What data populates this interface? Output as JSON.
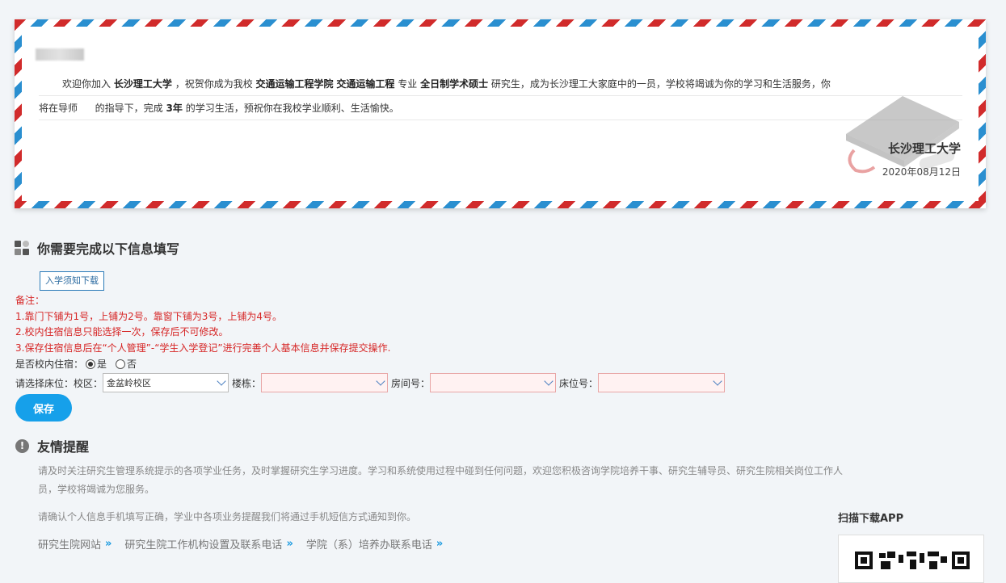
{
  "letter": {
    "intro": "欢迎你加入",
    "university": "长沙理工大学",
    "congrats": "，祝贺你成为我校",
    "college": "交通运输工程学院",
    "major": "交通运输工程",
    "major_suffix": "专业",
    "degree": "全日制学术硕士",
    "line1_tail": "研究生，成为长沙理工大家庭中的一员，学校将竭诚为你的学习和生活服务，你",
    "line2_a": "将在导师",
    "line2_b": "的指导下，完成",
    "years": "3年",
    "line2_c": "的学习生活，预祝你在我校学业顺利、生活愉快。",
    "signature": "长沙理工大学",
    "date": "2020年08月12日"
  },
  "section": {
    "title": "你需要完成以下信息填写",
    "notice_button": "入学须知下载",
    "remarks": [
      "备注：",
      "1.靠门下铺为1号，上铺为2号。靠窗下铺为3号，上铺为4号。",
      "2.校内住宿信息只能选择一次，保存后不可修改。",
      "3.保存住宿信息后在“个人管理”-“学生入学登记”进行完善个人基本信息并保存提交操作."
    ],
    "live_on_campus_label": "是否校内住宿：",
    "option_yes": "是",
    "option_no": "否",
    "bed_label": "请选择床位：校区：",
    "campus_value": "金盆岭校区",
    "building_label": "楼栋：",
    "building_value": "",
    "room_label": "房间号：",
    "room_value": "",
    "bed_no_label": "床位号：",
    "bed_no_value": "",
    "save_button": "保存"
  },
  "reminder": {
    "title": "友情提醒",
    "tip1_a": "请及时关注研究生管理系统提示的各项学业任务，及时掌握研究生学习进度。学习和系统使用过程中碰到任何问题，欢迎您积极咨询学院培养干事、研究生辅导员、研究生院相关岗位工作人",
    "tip1_b": "员，学校将竭诚为您服务。",
    "tip2": "请确认个人信息手机填写正确，学业中各项业务提醒我们将通过手机短信方式通知到你。",
    "links": [
      "研究生院网站",
      "研究生院工作机构设置及联系电话",
      "学院（系）培养办联系电话"
    ],
    "link_arrow": "»",
    "app_label": "扫描下载APP"
  },
  "colors": {
    "accent": "#16a0ea",
    "remark_red": "#d62525",
    "stripe_red": "#d12b2b",
    "stripe_blue": "#2a8fd0"
  }
}
